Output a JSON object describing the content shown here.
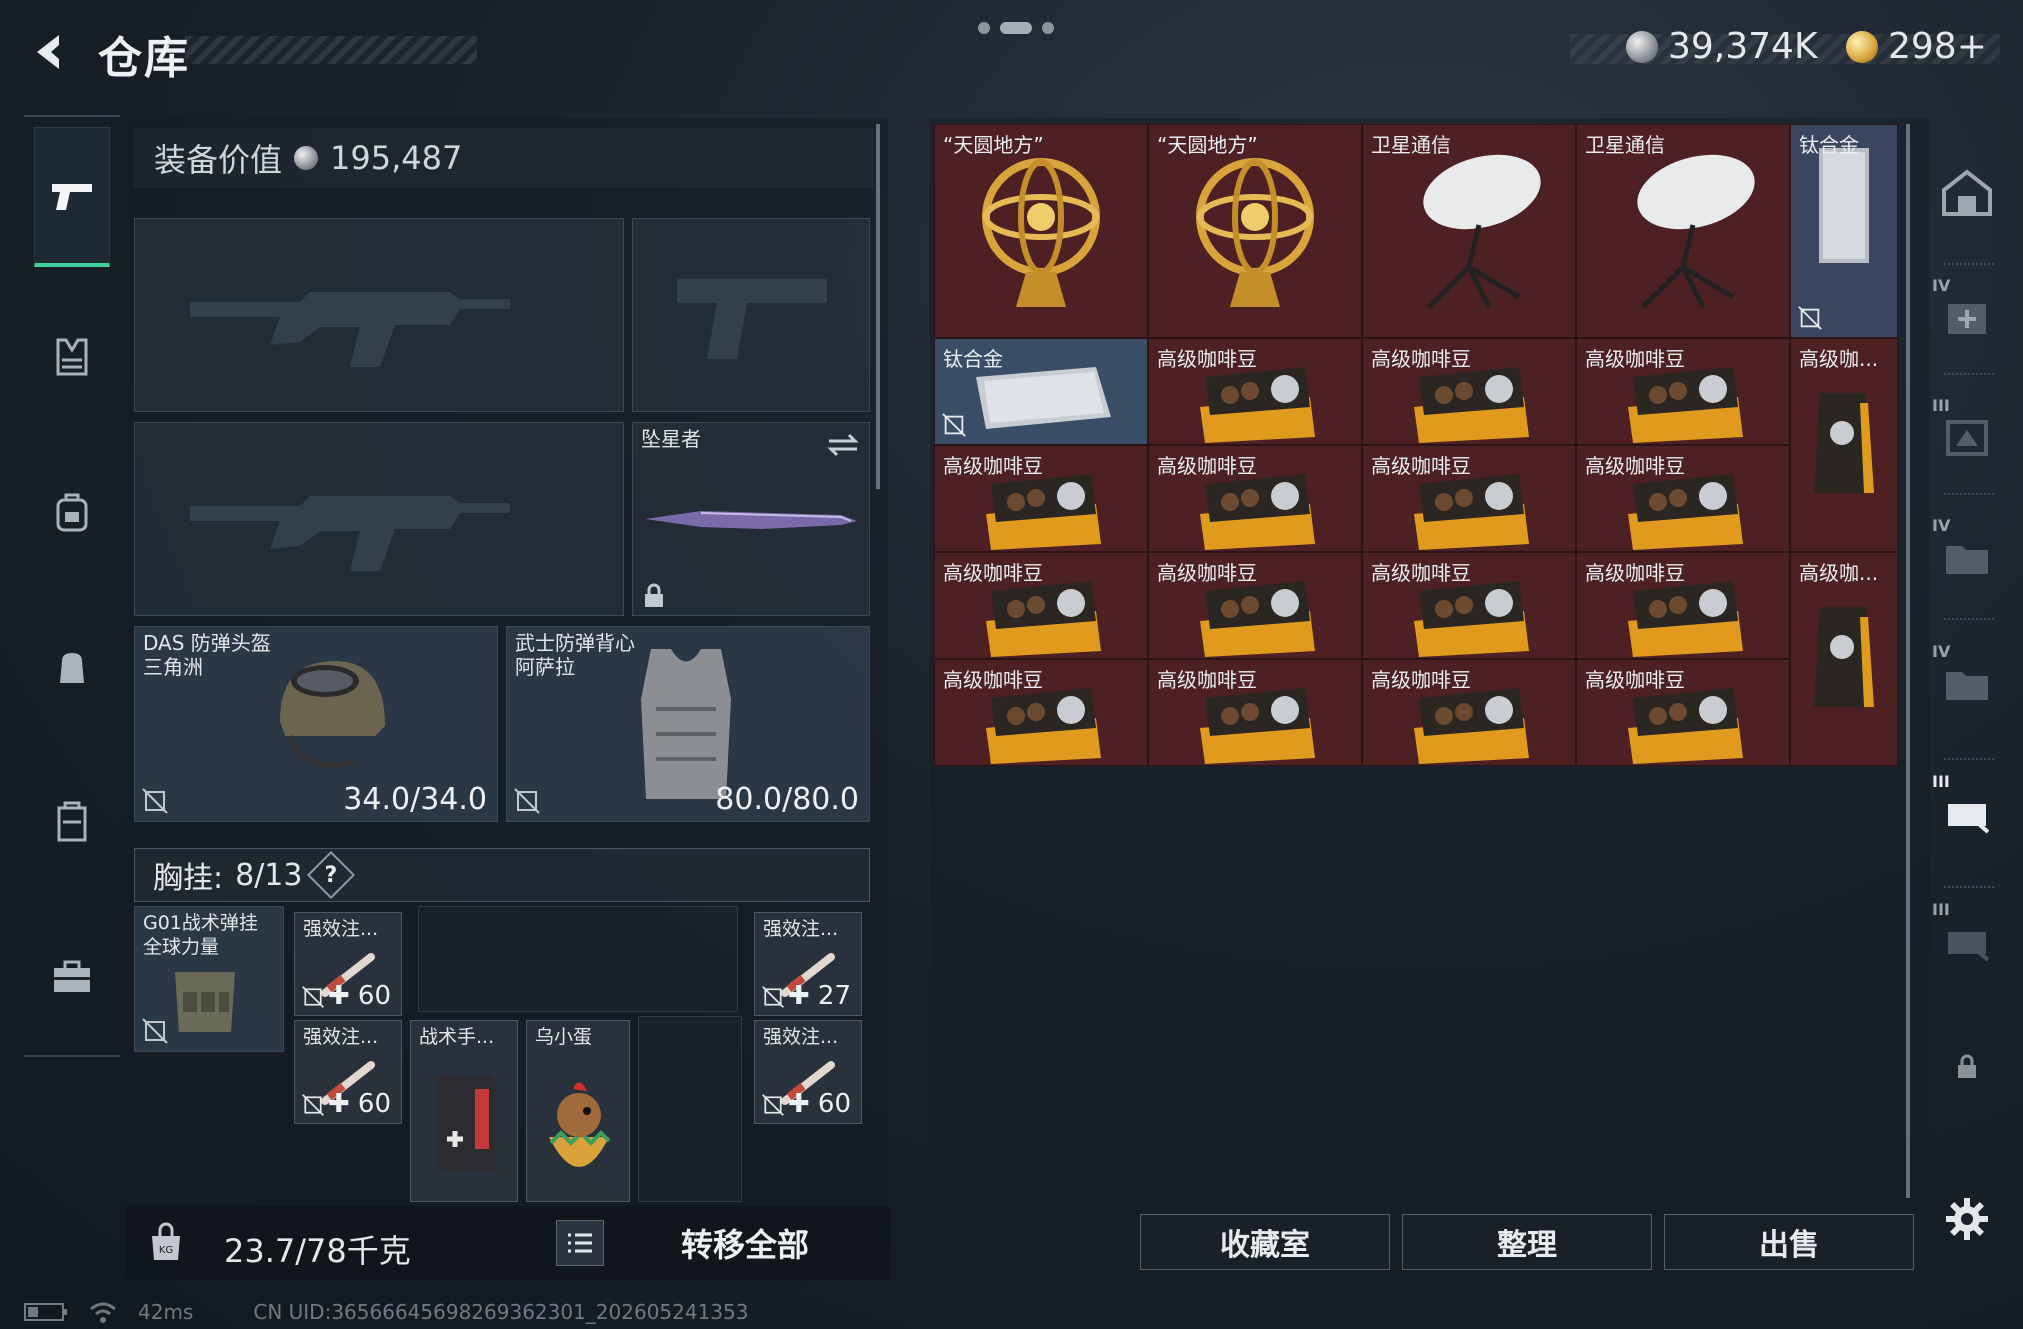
{
  "header": {
    "title": "仓库",
    "currency_silver": "39,374K",
    "currency_gold": "298+"
  },
  "equipment": {
    "value_label": "装备价值",
    "value": "195,487",
    "melee_name": "坠星者",
    "helmet_name": "DAS 防弹头盔",
    "helmet_brand": "三角洲",
    "helmet_durability": "34.0/34.0",
    "armor_name": "武士防弹背心",
    "armor_brand": "阿萨拉",
    "armor_durability": "80.0/80.0",
    "chest_label": "胸挂:",
    "chest_capacity": "8/13",
    "chest_rig_name": "G01战术弹挂",
    "chest_rig_brand": "全球力量",
    "items": [
      {
        "label": "强效注...",
        "count": "60"
      },
      {
        "label": "强效注...",
        "count": "60"
      },
      {
        "label": "战术手..."
      },
      {
        "label": "乌小蛋"
      },
      {
        "label": "强效注...",
        "count": "27"
      },
      {
        "label": "强效注...",
        "count": "60"
      }
    ]
  },
  "bottom_left": {
    "weight": "23.7/78千克",
    "transfer_all": "转移全部"
  },
  "stash": {
    "cells": [
      {
        "label": "“天圆地方”",
        "type": "armillary"
      },
      {
        "label": "“天圆地方”",
        "type": "armillary"
      },
      {
        "label": "卫星通信",
        "type": "dish"
      },
      {
        "label": "卫星通信",
        "type": "dish"
      },
      {
        "label": "钛合金",
        "type": "titanium-v"
      },
      {
        "label": "钛合金",
        "type": "titanium-h"
      },
      {
        "label": "高级咖啡豆",
        "type": "coffee"
      },
      {
        "label": "高级咖啡豆",
        "type": "coffee"
      },
      {
        "label": "高级咖啡豆",
        "type": "coffee"
      },
      {
        "label": "高级咖...",
        "type": "coffee-bag"
      },
      {
        "label": "高级咖啡豆",
        "type": "coffee"
      },
      {
        "label": "高级咖啡豆",
        "type": "coffee"
      },
      {
        "label": "高级咖啡豆",
        "type": "coffee"
      },
      {
        "label": "高级咖啡豆",
        "type": "coffee"
      },
      {
        "label": "高级咖啡豆",
        "type": "coffee"
      },
      {
        "label": "高级咖啡豆",
        "type": "coffee"
      },
      {
        "label": "高级咖啡豆",
        "type": "coffee"
      },
      {
        "label": "高级咖啡豆",
        "type": "coffee"
      },
      {
        "label": "高级咖...",
        "type": "coffee-bag"
      },
      {
        "label": "高级咖啡豆",
        "type": "coffee"
      },
      {
        "label": "高级咖啡豆",
        "type": "coffee"
      },
      {
        "label": "高级咖啡豆",
        "type": "coffee"
      },
      {
        "label": "高级咖啡豆",
        "type": "coffee"
      }
    ]
  },
  "bottom_right": {
    "collection": "收藏室",
    "organize": "整理",
    "sell": "出售"
  },
  "right_nav": {
    "tiers": [
      "IV",
      "III",
      "IV",
      "IV",
      "III",
      "III"
    ]
  },
  "status": {
    "ping": "42ms",
    "uid": "CN UID:3656664569826936​2301_202605241353"
  }
}
